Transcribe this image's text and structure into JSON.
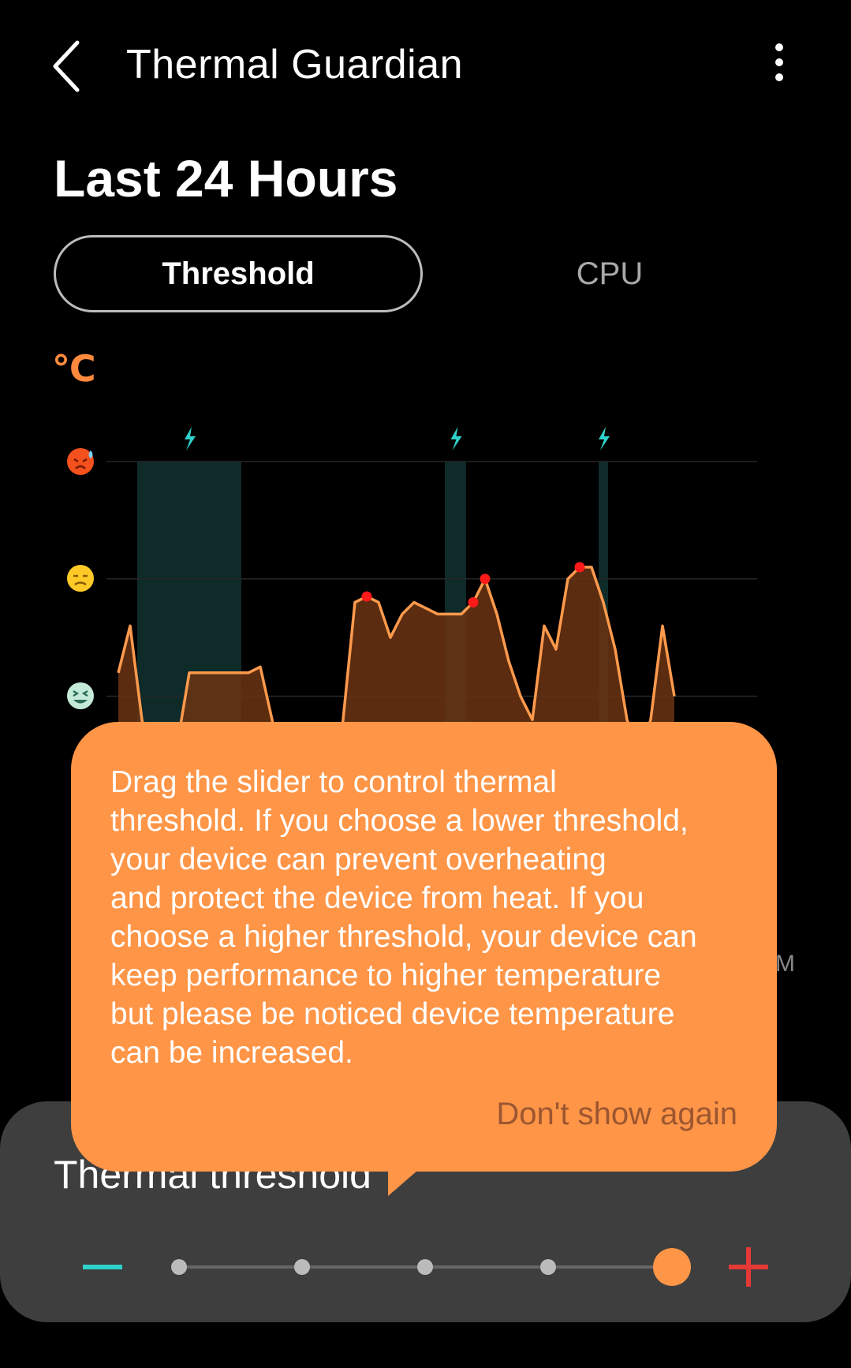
{
  "header": {
    "title": "Thermal Guardian",
    "back_icon": "chevron-left-icon",
    "more_icon": "more-vertical-icon"
  },
  "section": {
    "title": "Last 24 Hours"
  },
  "tabs": [
    {
      "label": "Threshold",
      "active": true
    },
    {
      "label": "CPU",
      "active": false
    }
  ],
  "chart": {
    "unit_label": "℃",
    "level_icons": [
      "hot-face-icon",
      "worried-face-icon",
      "grin-face-icon",
      "cool-face-icon",
      "cold-face-icon"
    ],
    "charging_icon": "lightning-icon",
    "partial_axis_label": "M",
    "colors": {
      "line": "#ff9a4d",
      "fill": "#6b3412",
      "charging": "#0e2a29",
      "marker": "#ff1a1a",
      "bolt": "#2ed1c9"
    }
  },
  "chart_data": {
    "type": "area",
    "x": [
      0,
      1,
      2,
      3,
      4,
      5,
      6,
      7,
      8,
      9,
      10,
      11,
      12,
      13,
      14,
      15,
      16,
      17,
      18,
      19,
      20,
      21,
      22,
      23,
      24,
      25,
      26,
      27,
      28,
      29,
      30,
      31,
      32,
      33,
      34,
      35,
      36,
      37,
      38,
      39,
      40,
      41,
      42,
      43,
      44,
      45,
      46,
      47
    ],
    "values": [
      2.2,
      2.6,
      1.8,
      1.1,
      1.3,
      1.6,
      2.2,
      2.2,
      2.2,
      2.2,
      2.2,
      2.2,
      2.25,
      1.8,
      1.2,
      1.0,
      1.0,
      1.0,
      1.0,
      1.8,
      2.8,
      2.85,
      2.8,
      2.5,
      2.7,
      2.8,
      2.75,
      2.7,
      2.7,
      2.7,
      2.8,
      3.0,
      2.7,
      2.3,
      2.0,
      1.8,
      2.6,
      2.4,
      3.0,
      3.1,
      3.1,
      2.8,
      2.4,
      1.8,
      1.5,
      1.8,
      2.6,
      2.0
    ],
    "markers": [
      21,
      30,
      31,
      39
    ],
    "charging_ranges": [
      [
        2,
        10
      ],
      [
        28,
        29
      ],
      [
        41,
        41
      ]
    ],
    "ylim": [
      0,
      4
    ]
  },
  "bottom_sheet": {
    "title": "Thermal threshold",
    "minus_icon": "minus-icon",
    "plus_icon": "plus-icon",
    "slider": {
      "steps": 5,
      "selected_index": 4
    }
  },
  "tooltip": {
    "text": "Drag the slider to control thermal\nthreshold. If you choose a lower threshold,\nyour device can prevent overheating\nand protect the device from heat. If you\nchoose a higher threshold, your device can\nkeep performance to higher temperature\nbut please be noticed device temperature\ncan be increased.",
    "action": "Don't show again"
  }
}
